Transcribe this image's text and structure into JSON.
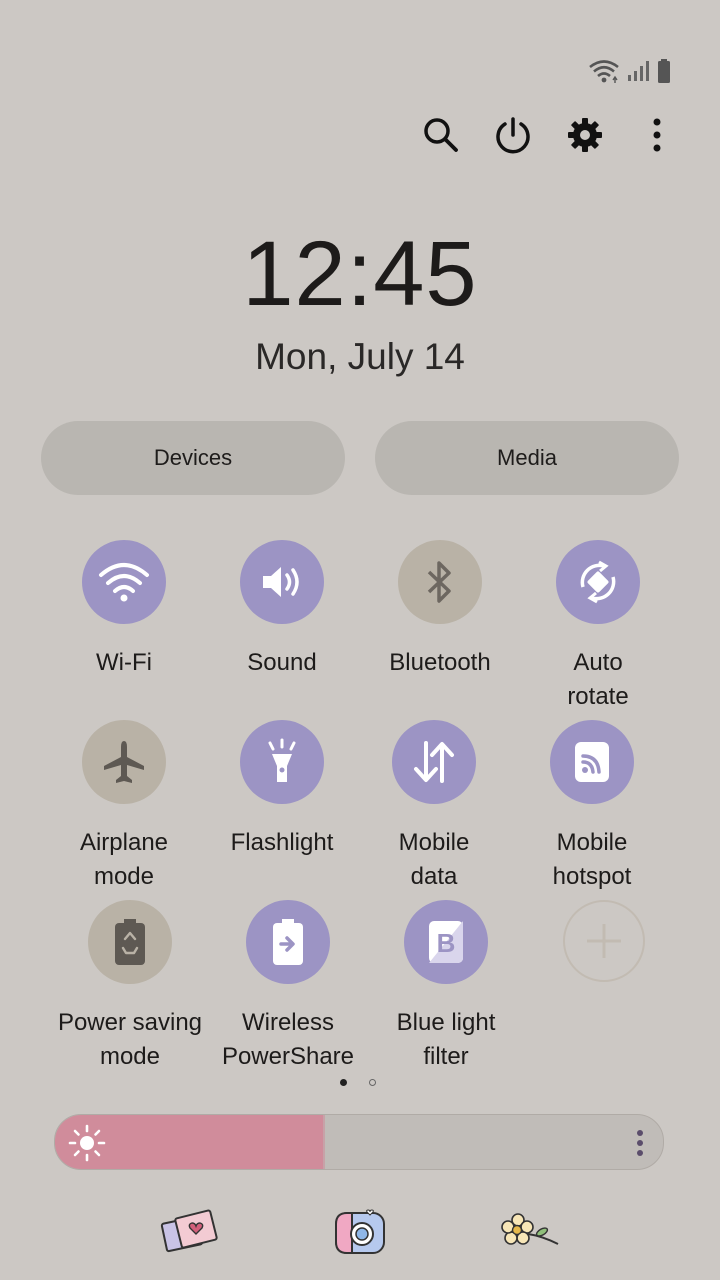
{
  "status_icons": [
    "wifi-icon",
    "signal-icon",
    "battery-icon"
  ],
  "top_actions": [
    "search-icon",
    "power-icon",
    "gear-icon",
    "more-vertical-icon"
  ],
  "clock": {
    "time": "12:45",
    "date": "Mon, July 14"
  },
  "pills": {
    "devices": "Devices",
    "media": "Media"
  },
  "tiles": [
    {
      "label": "Wi-Fi",
      "state": "on",
      "icon": "wifi-icon"
    },
    {
      "label": "Sound",
      "state": "on",
      "icon": "volume-icon"
    },
    {
      "label": "Bluetooth",
      "state": "off",
      "icon": "bluetooth-icon"
    },
    {
      "label": "Auto\nrotate",
      "state": "on",
      "icon": "rotate-icon"
    },
    {
      "label": "Airplane\nmode",
      "state": "off",
      "icon": "airplane-icon"
    },
    {
      "label": "Flashlight",
      "state": "on",
      "icon": "flashlight-icon"
    },
    {
      "label": "Mobile\ndata",
      "state": "on",
      "icon": "mobile-data-icon"
    },
    {
      "label": "Mobile\nhotspot",
      "state": "on",
      "icon": "hotspot-icon"
    },
    {
      "label": "Power saving\nmode",
      "state": "off",
      "icon": "power-saving-icon"
    },
    {
      "label": "Wireless\nPowerShare",
      "state": "on",
      "icon": "powershare-icon"
    },
    {
      "label": "Blue light\nfilter",
      "state": "on",
      "icon": "blue-light-icon"
    },
    {
      "label": "",
      "state": "add",
      "icon": "plus-icon"
    }
  ],
  "pagination": {
    "current": 1,
    "total": 2
  },
  "brightness": {
    "level": 0.44
  },
  "colors": {
    "background": "#ccc8c4",
    "tile_on": "#9c94c4",
    "tile_off": "#b9b2a6",
    "brightness_fill": "#d08c9b"
  },
  "dock": [
    "photo-sticker-icon",
    "camera-sticker-icon",
    "flower-sticker-icon"
  ]
}
